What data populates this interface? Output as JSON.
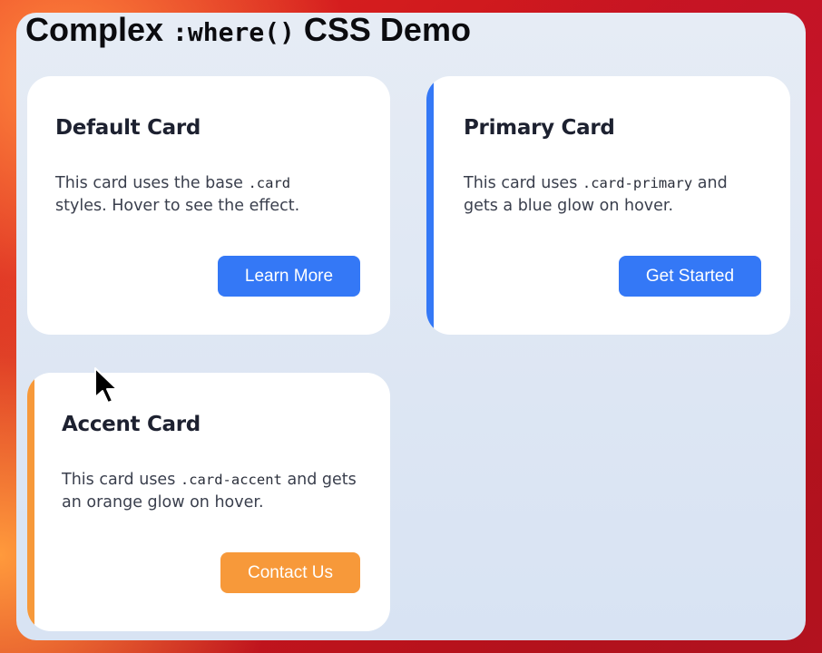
{
  "page": {
    "title_prefix": "Complex ",
    "title_code": ":where()",
    "title_suffix": " CSS Demo"
  },
  "cards": {
    "default": {
      "title": "Default Card",
      "text_before": "This card uses the base ",
      "text_code": ".card",
      "text_after": " styles. Hover to see the effect.",
      "button": "Learn More",
      "accent_color": ""
    },
    "primary": {
      "title": "Primary Card",
      "text_before": "This card uses ",
      "text_code": ".card-primary",
      "text_after": " and gets a blue glow on hover.",
      "button": "Get Started",
      "accent_color": "#3478f6"
    },
    "accent": {
      "title": "Accent Card",
      "text_before": "This card uses ",
      "text_code": ".card-accent",
      "text_after": " and gets an orange glow on hover.",
      "button": "Contact Us",
      "accent_color": "#f7993a"
    }
  },
  "colors": {
    "primary_button": "#3478f6",
    "accent_button": "#f7993a",
    "window_background": "#e2e9f4"
  },
  "icons": {
    "cursor": "mouse-pointer-icon"
  }
}
